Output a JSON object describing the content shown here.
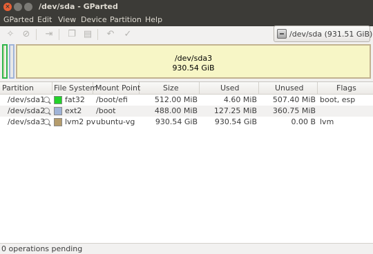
{
  "window": {
    "title": "/dev/sda - GParted"
  },
  "menu": [
    "GParted",
    "Edit",
    "View",
    "Device",
    "Partition",
    "Help"
  ],
  "toolbar": {
    "icons": [
      "new-icon",
      "delete-icon",
      "resize-move-icon",
      "copy-icon",
      "paste-icon",
      "undo-icon",
      "apply-icon"
    ]
  },
  "device": {
    "label": "/dev/sda  (931.51 GiB)"
  },
  "diskmap": {
    "main_partition": {
      "name": "/dev/sda3",
      "size": "930.54 GiB"
    },
    "colors": {
      "fat32": "#22d22a",
      "ext2": "#9fb3d7",
      "lvm2pv": "#b59c6c"
    }
  },
  "table": {
    "headers": [
      "Partition",
      "File System",
      "Mount Point",
      "Size",
      "Used",
      "Unused",
      "Flags"
    ],
    "rows": [
      {
        "partition": "/dev/sda1",
        "fs": "fat32",
        "fs_color": "#22d22a",
        "mount": "/boot/efi",
        "size": "512.00 MiB",
        "used": "4.60 MiB",
        "unused": "507.40 MiB",
        "flags": "boot, esp"
      },
      {
        "partition": "/dev/sda2",
        "fs": "ext2",
        "fs_color": "#9fb3d7",
        "mount": "/boot",
        "size": "488.00 MiB",
        "used": "127.25 MiB",
        "unused": "360.75 MiB",
        "flags": ""
      },
      {
        "partition": "/dev/sda3",
        "fs": "lvm2 pv",
        "fs_color": "#b59c6c",
        "mount": "ubuntu-vg",
        "size": "930.54 GiB",
        "used": "930.54 GiB",
        "unused": "0.00 B",
        "flags": "lvm"
      }
    ]
  },
  "status": {
    "text": "0 operations pending"
  }
}
